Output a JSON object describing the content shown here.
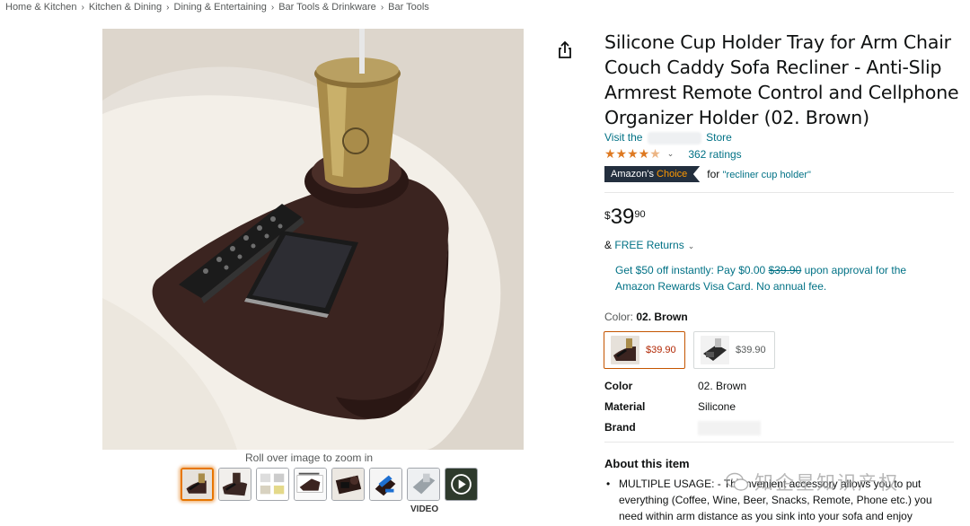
{
  "breadcrumb": [
    "Home & Kitchen",
    "Kitchen & Dining",
    "Dining & Entertaining",
    "Bar Tools & Drinkware",
    "Bar Tools"
  ],
  "breadcrumb_separator": "›",
  "gallery": {
    "zoom_hint": "Roll over image to zoom in",
    "video_label": "VIDEO",
    "thumb_count": 8
  },
  "product": {
    "title": "Silicone Cup Holder Tray for Arm Chair Couch Caddy Sofa Recliner - Anti-Slip Armrest Remote Control and Cellphone Organizer Holder (02. Brown)",
    "store_prefix": "Visit the",
    "store_suffix": "Store",
    "stars": "★★★★",
    "star_half": "★",
    "star_empty": "☆",
    "ratings_text": "362 ratings",
    "rating_chevron": "⌄",
    "choice": {
      "badge_main": "Amazon's",
      "badge_accent": "Choice",
      "for_label": "for",
      "query": "\"recliner cup holder\""
    },
    "price": {
      "symbol": "$",
      "whole": "39",
      "fraction": "90"
    },
    "returns": {
      "prefix": "&",
      "link": "FREE Returns",
      "chevron": "⌄"
    },
    "promo": {
      "text_before": "Get $50 off instantly: Pay $0.00",
      "strike": "$39.90",
      "text_after": "upon approval for the Amazon Rewards Visa Card. No annual fee."
    },
    "color": {
      "label": "Color:",
      "selected": "02. Brown"
    },
    "swatches": [
      {
        "price": "$39.90",
        "selected": true
      },
      {
        "price": "$39.90",
        "selected": false
      }
    ],
    "specs": [
      {
        "key": "Color",
        "value": "02. Brown"
      },
      {
        "key": "Material",
        "value": "Silicone"
      },
      {
        "key": "Brand",
        "value": ""
      }
    ],
    "about_title": "About this item",
    "about_bullet": "MULTIPLE USAGE: - Th  onvenient accessory allows you to put everything (Coffee, Wine, Beer, Snacks, Remote, Phone etc.) you need within arm distance as you sink into your sofa and enjoy"
  },
  "watermark_text": "知企星知识产权",
  "colors": {
    "link": "#007185",
    "rating": "#de7921",
    "badge_bg": "#232f3e",
    "badge_accent": "#ff9900",
    "price_red": "#b12704",
    "selected_border": "#c45500"
  }
}
